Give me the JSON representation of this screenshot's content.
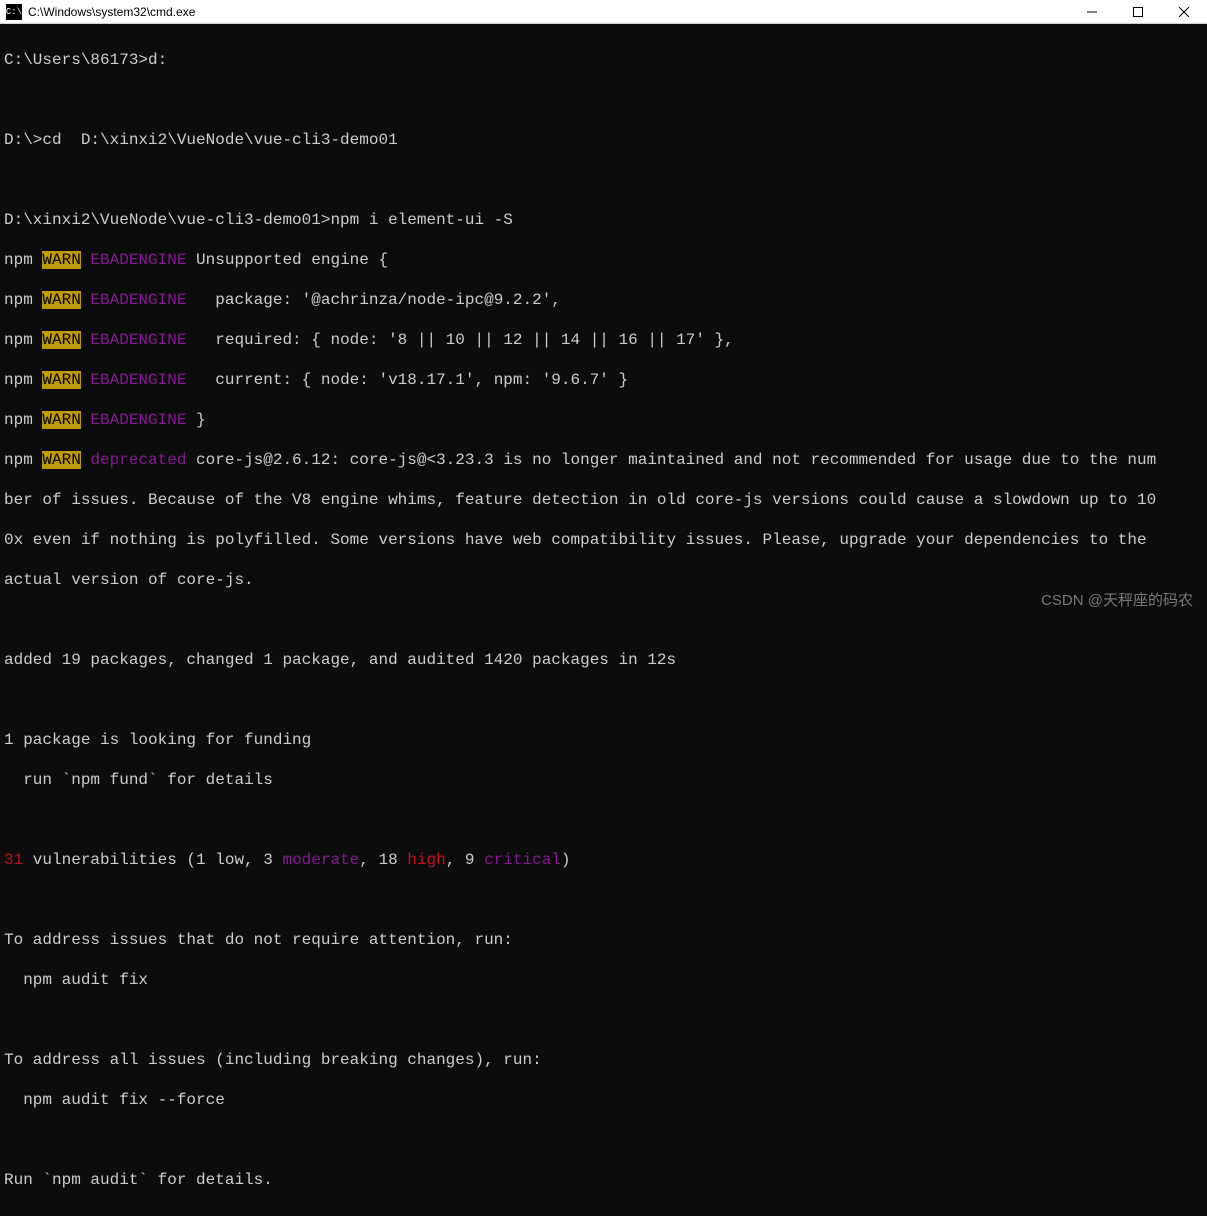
{
  "window": {
    "title": "C:\\Windows\\system32\\cmd.exe",
    "icon_label": "C:\\"
  },
  "term": {
    "l1_prompt": "C:\\Users\\86173>",
    "l1_cmd": "d:",
    "l2_prompt": "D:\\>",
    "l2_cmd": "cd  D:\\xinxi2\\VueNode\\vue-cli3-demo01",
    "l3_prompt": "D:\\xinxi2\\VueNode\\vue-cli3-demo01>",
    "l3_cmd": "npm i element-ui -S",
    "npm": "npm ",
    "warn": "WARN",
    "ebad": " EBADENGINE",
    "w1": " Unsupported engine {",
    "w2": "   package: '@achrinza/node-ipc@9.2.2',",
    "w3": "   required: { node: '8 || 10 || 12 || 14 || 16 || 17' },",
    "w4": "   current: { node: 'v18.17.1', npm: '9.6.7' }",
    "w5": " }",
    "depr_label": " deprecated",
    "depr_text": " core-js@2.6.12: core-js@<3.23.3 is no longer maintained and not recommended for usage due to the num",
    "depr_cont1": "ber of issues. Because of the V8 engine whims, feature detection in old core-js versions could cause a slowdown up to 10",
    "depr_cont2": "0x even if nothing is polyfilled. Some versions have web compatibility issues. Please, upgrade your dependencies to the",
    "depr_cont3": "actual version of core-js.",
    "added": "added 19 packages, changed 1 package, and audited 1420 packages in 12s",
    "funding1": "1 package is looking for funding",
    "funding2": "  run `npm fund` for details",
    "vuln_count": "31",
    "vuln_mid1": " vulnerabilities (1 low, 3 ",
    "vuln_moderate": "moderate",
    "vuln_mid2": ", 18 ",
    "vuln_high": "high",
    "vuln_mid3": ", 9 ",
    "vuln_critical": "critical",
    "vuln_end": ")",
    "addr1": "To address issues that do not require attention, run:",
    "addr2": "  npm audit fix",
    "addr3": "To address all issues (including breaking changes), run:",
    "addr4": "  npm audit fix --force",
    "audit": "Run `npm audit` for details."
  },
  "watermark": "CSDN @天秤座的码农"
}
